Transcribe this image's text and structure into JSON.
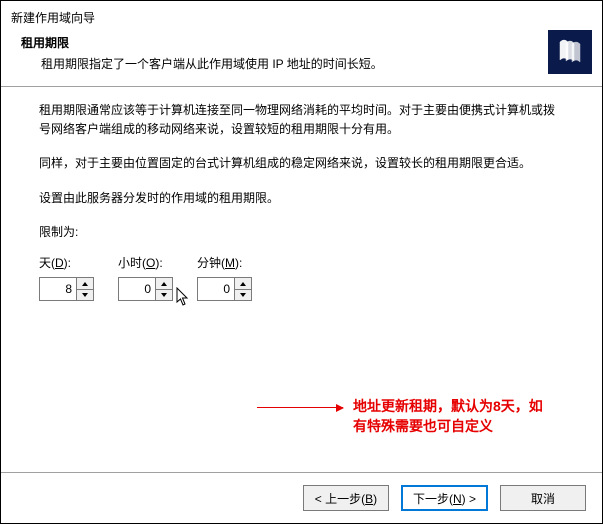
{
  "window_title": "新建作用域向导",
  "header": {
    "heading": "租用期限",
    "subheading": "租用期限指定了一个客户端从此作用域使用 IP 地址的时间长短。"
  },
  "body": {
    "para1": "租用期限通常应该等于计算机连接至同一物理网络消耗的平均时间。对于主要由便携式计算机或拨号网络客户端组成的移动网络来说，设置较短的租用期限十分有用。",
    "para2": "同样，对于主要由位置固定的台式计算机组成的稳定网络来说，设置较长的租用期限更合适。",
    "para3": "设置由此服务器分发时的作用域的租用期限。",
    "limit_label": "限制为:",
    "days_label_pre": "天(",
    "days_key": "D",
    "days_label_post": "):",
    "hours_label_pre": "小时(",
    "hours_key": "O",
    "hours_label_post": "):",
    "minutes_label_pre": "分钟(",
    "minutes_key": "M",
    "minutes_label_post": "):",
    "days_value": "8",
    "hours_value": "0",
    "minutes_value": "0"
  },
  "annotation": "地址更新租期，默认为8天，如有特殊需要也可自定义",
  "buttons": {
    "back_pre": "< 上一步(",
    "back_key": "B",
    "back_post": ")",
    "next_pre": "下一步(",
    "next_key": "N",
    "next_post": ") >",
    "cancel": "取消"
  }
}
